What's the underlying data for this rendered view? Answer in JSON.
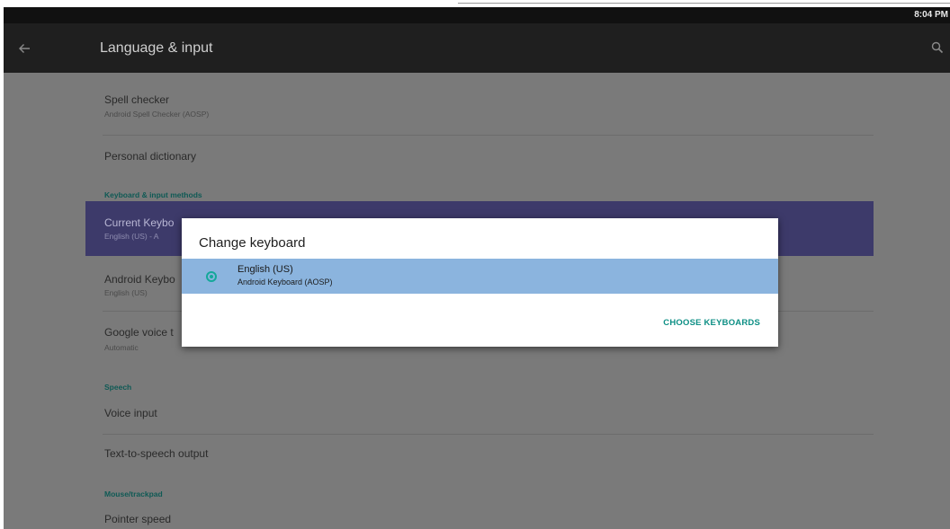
{
  "status_bar": {
    "time": "8:04 PM"
  },
  "app_bar": {
    "title": "Language & input",
    "back_icon": "arrow-left-icon",
    "search_icon": "search-icon"
  },
  "preferences": {
    "spell_checker": {
      "title": "Spell checker",
      "summary": "Android Spell Checker (AOSP)"
    },
    "personal_dictionary": {
      "title": "Personal dictionary"
    },
    "keyboard_category": "Keyboard & input methods",
    "current_keyboard": {
      "title": "Current Keybo",
      "summary": "English (US) - A"
    },
    "android_keyboard": {
      "title": "Android Keybo",
      "summary": "English (US)"
    },
    "google_voice": {
      "title": "Google voice t",
      "summary": "Automatic"
    },
    "speech_category": "Speech",
    "voice_input": {
      "title": "Voice input"
    },
    "tts_output": {
      "title": "Text-to-speech output"
    },
    "mouse_category": "Mouse/trackpad",
    "pointer_speed": {
      "title": "Pointer speed"
    }
  },
  "dialog": {
    "title": "Change keyboard",
    "option": {
      "title": "English (US)",
      "subtitle": "Android Keyboard (AOSP)",
      "selected": true
    },
    "choose_button": "CHOOSE KEYBOARDS"
  },
  "colors": {
    "accent": "#14a89a",
    "highlight": "#3d3a6a",
    "option_selected_bg": "#8bb4de",
    "scrim": "#7a7a7a"
  }
}
